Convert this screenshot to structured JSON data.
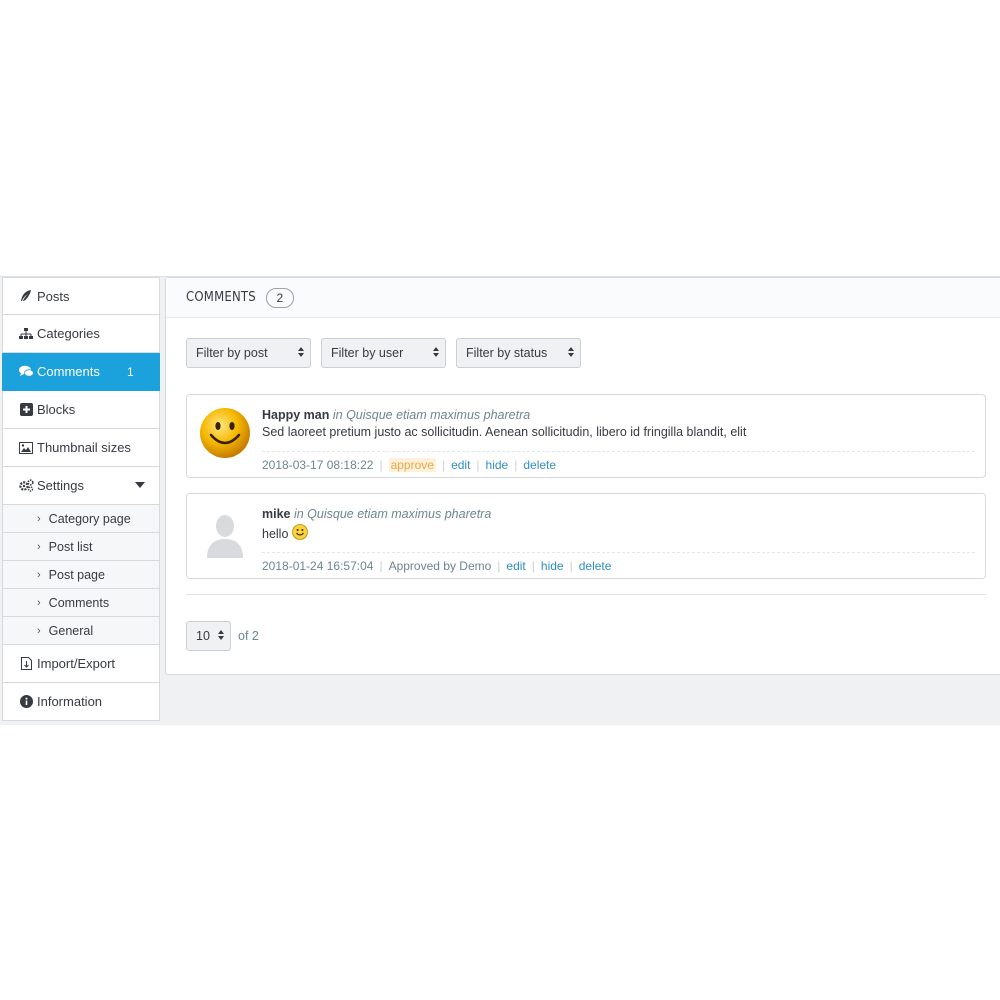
{
  "sidebar": {
    "items": [
      {
        "label": "Posts",
        "icon": "feather-icon"
      },
      {
        "label": "Categories",
        "icon": "sitemap-icon"
      },
      {
        "label": "Comments",
        "icon": "comments-icon",
        "badge": "1",
        "active": true
      },
      {
        "label": "Blocks",
        "icon": "plus-square-icon"
      },
      {
        "label": "Thumbnail sizes",
        "icon": "image-icon"
      },
      {
        "label": "Settings",
        "icon": "cogs-icon"
      }
    ],
    "settings_sub": [
      "Category page",
      "Post list",
      "Post page",
      "Comments",
      "General"
    ],
    "bottom_items": [
      {
        "label": "Import/Export",
        "icon": "file-icon"
      },
      {
        "label": "Information",
        "icon": "info-circle-icon"
      }
    ]
  },
  "panel": {
    "title": "COMMENTS",
    "count": "2",
    "filters": [
      "Filter by post",
      "Filter by user",
      "Filter by status"
    ]
  },
  "comments": [
    {
      "author": "Happy man",
      "in_post": "in Quisque etiam maximus pharetra",
      "text": "Sed laoreet pretium justo ac sollicitudin. Aenean sollicitudin, libero id fringilla blandit, elit",
      "date": "2018-03-17 08:18:22",
      "actions": [
        "approve",
        "edit",
        "hide",
        "delete"
      ],
      "avatar": "smiley-avatar"
    },
    {
      "author": "mike",
      "in_post": "in Quisque etiam maximus pharetra",
      "text": "hello",
      "date": "2018-01-24 16:57:04",
      "status": "Approved by Demo",
      "actions": [
        "edit",
        "hide",
        "delete"
      ],
      "avatar": "default-user-avatar"
    }
  ],
  "pagination": {
    "per_page": "10",
    "of_label": "of 2"
  },
  "colors": {
    "accent": "#1ba1dc",
    "link": "#2e8fc6",
    "approve": "#e5a84b"
  }
}
